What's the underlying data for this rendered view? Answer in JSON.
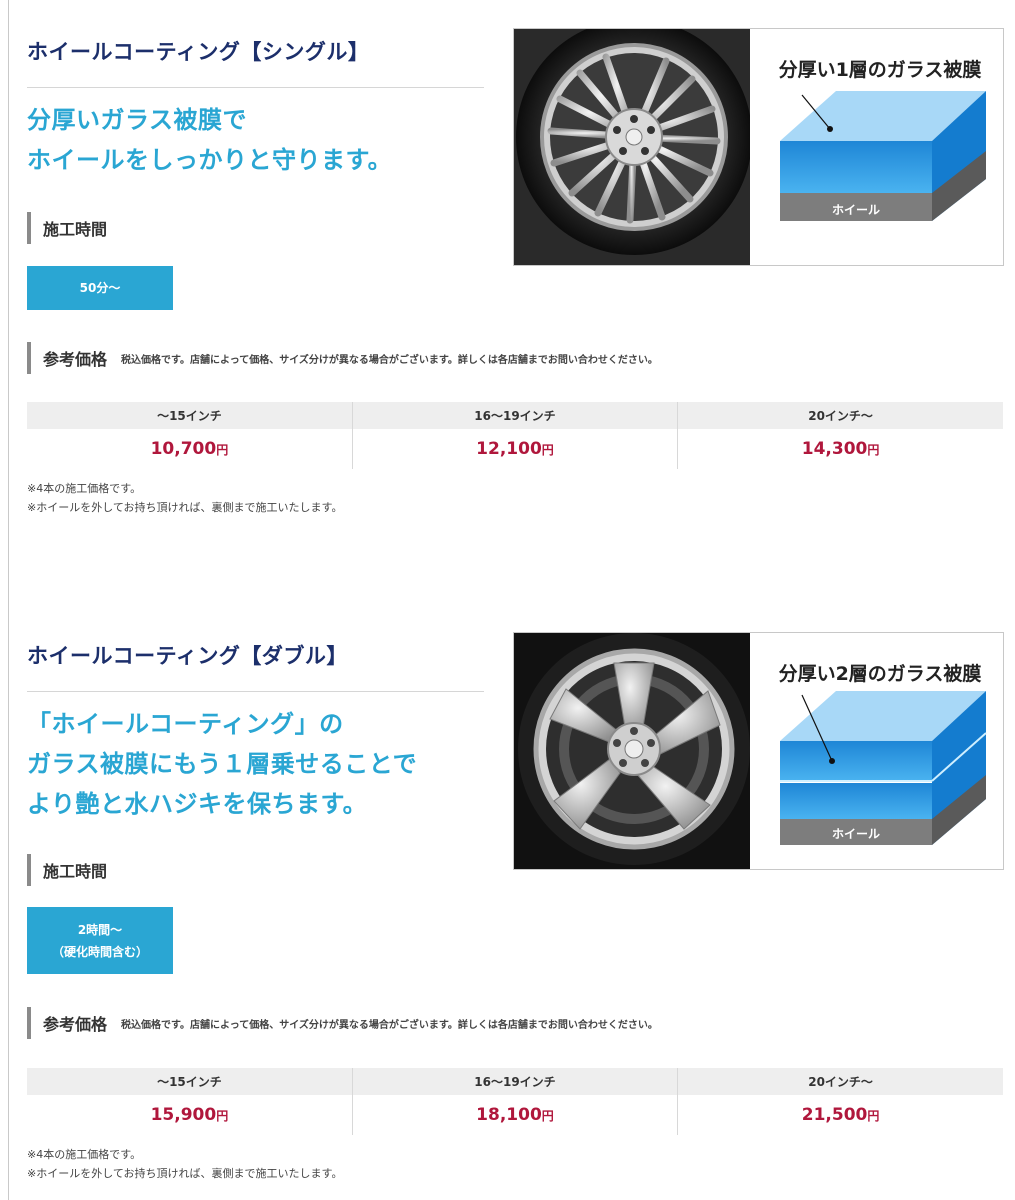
{
  "sections": [
    {
      "title": "ホイールコーティング【シングル】",
      "lead": [
        "分厚いガラス被膜で",
        "ホイールをしっかりと守ります。"
      ],
      "time_heading": "施工時間",
      "time_lines": [
        "50分～"
      ],
      "price_heading": "参考価格",
      "price_note": "税込価格です。店舗によって価格、サイズ分けが異なる場合がございます。詳しくは各店舗までお問い合わせください。",
      "price_headers": [
        "～15インチ",
        "16～19インチ",
        "20インチ～"
      ],
      "prices": [
        "10,700",
        "12,100",
        "14,300"
      ],
      "currency": "円",
      "notes": [
        "※4本の施工価格です。",
        "※ホイールを外してお持ち頂ければ、裏側まで施工いたします。"
      ],
      "diagram_label": "分厚い1層のガラス被膜",
      "diagram_base_label": "ホイール",
      "glass_layers": 1,
      "wheel_icon": "multi-spoke-wheel-photo"
    },
    {
      "title": "ホイールコーティング【ダブル】",
      "lead": [
        "「ホイールコーティング」の",
        "ガラス被膜にもう１層乗せることで",
        "より艶と水ハジキを保ちます。"
      ],
      "time_heading": "施工時間",
      "time_lines": [
        "2時間～",
        "（硬化時間含む）"
      ],
      "price_heading": "参考価格",
      "price_note": "税込価格です。店舗によって価格、サイズ分けが異なる場合がございます。詳しくは各店舗までお問い合わせください。",
      "price_headers": [
        "～15インチ",
        "16～19インチ",
        "20インチ～"
      ],
      "prices": [
        "15,900",
        "18,100",
        "21,500"
      ],
      "currency": "円",
      "notes": [
        "※4本の施工価格です。",
        "※ホイールを外してお持ち頂ければ、裏側まで施工いたします。"
      ],
      "diagram_label": "分厚い2層のガラス被膜",
      "diagram_base_label": "ホイール",
      "glass_layers": 2,
      "wheel_icon": "five-spoke-wheel-photo"
    }
  ],
  "colors": {
    "title": "#1c2f6b",
    "lead": "#2aa6d3",
    "time_box": "#2aa6d3",
    "price": "#b0173c",
    "glass": "#2a9be6"
  }
}
